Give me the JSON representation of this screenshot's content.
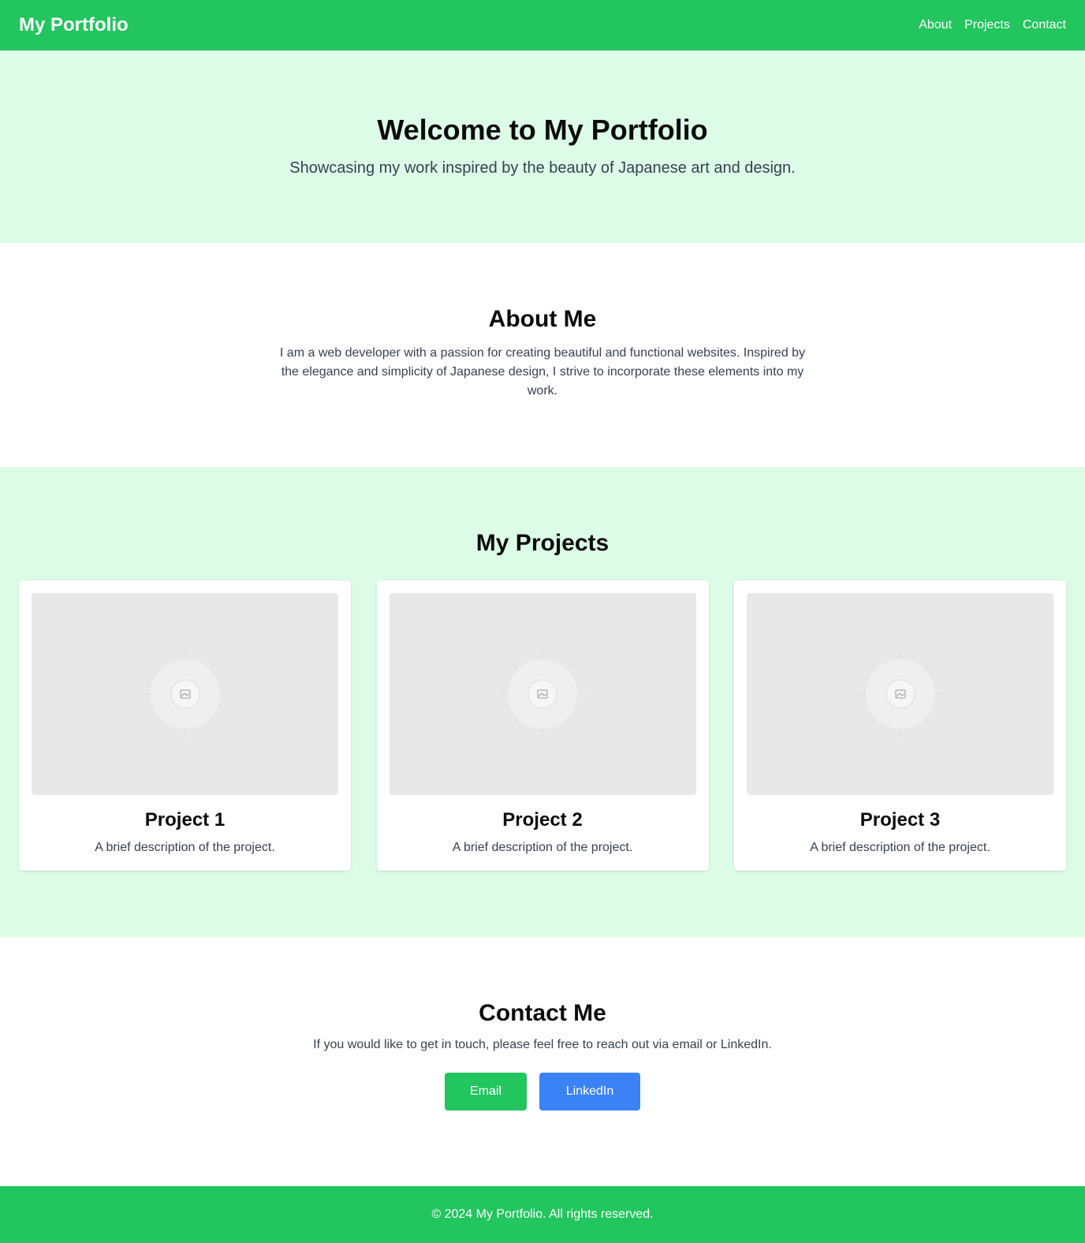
{
  "nav": {
    "brand": "My Portfolio",
    "links": [
      "About",
      "Projects",
      "Contact"
    ]
  },
  "hero": {
    "title": "Welcome to My Portfolio",
    "subtitle": "Showcasing my work inspired by the beauty of Japanese art and design."
  },
  "about": {
    "title": "About Me",
    "text": "I am a web developer with a passion for creating beautiful and functional websites. Inspired by the elegance and simplicity of Japanese design, I strive to incorporate these elements into my work."
  },
  "projects": {
    "title": "My Projects",
    "items": [
      {
        "title": "Project 1",
        "description": "A brief description of the project.",
        "image_icon": "image-placeholder-icon"
      },
      {
        "title": "Project 2",
        "description": "A brief description of the project.",
        "image_icon": "image-placeholder-icon"
      },
      {
        "title": "Project 3",
        "description": "A brief description of the project.",
        "image_icon": "image-placeholder-icon"
      }
    ]
  },
  "contact": {
    "title": "Contact Me",
    "text": "If you would like to get in touch, please feel free to reach out via email or LinkedIn.",
    "email_label": "Email",
    "linkedin_label": "LinkedIn"
  },
  "footer": {
    "text": "© 2024 My Portfolio. All rights reserved."
  },
  "colors": {
    "primary_green": "#22c55e",
    "light_green_bg": "#dcfce7",
    "linkedin_blue": "#3b82f6"
  }
}
